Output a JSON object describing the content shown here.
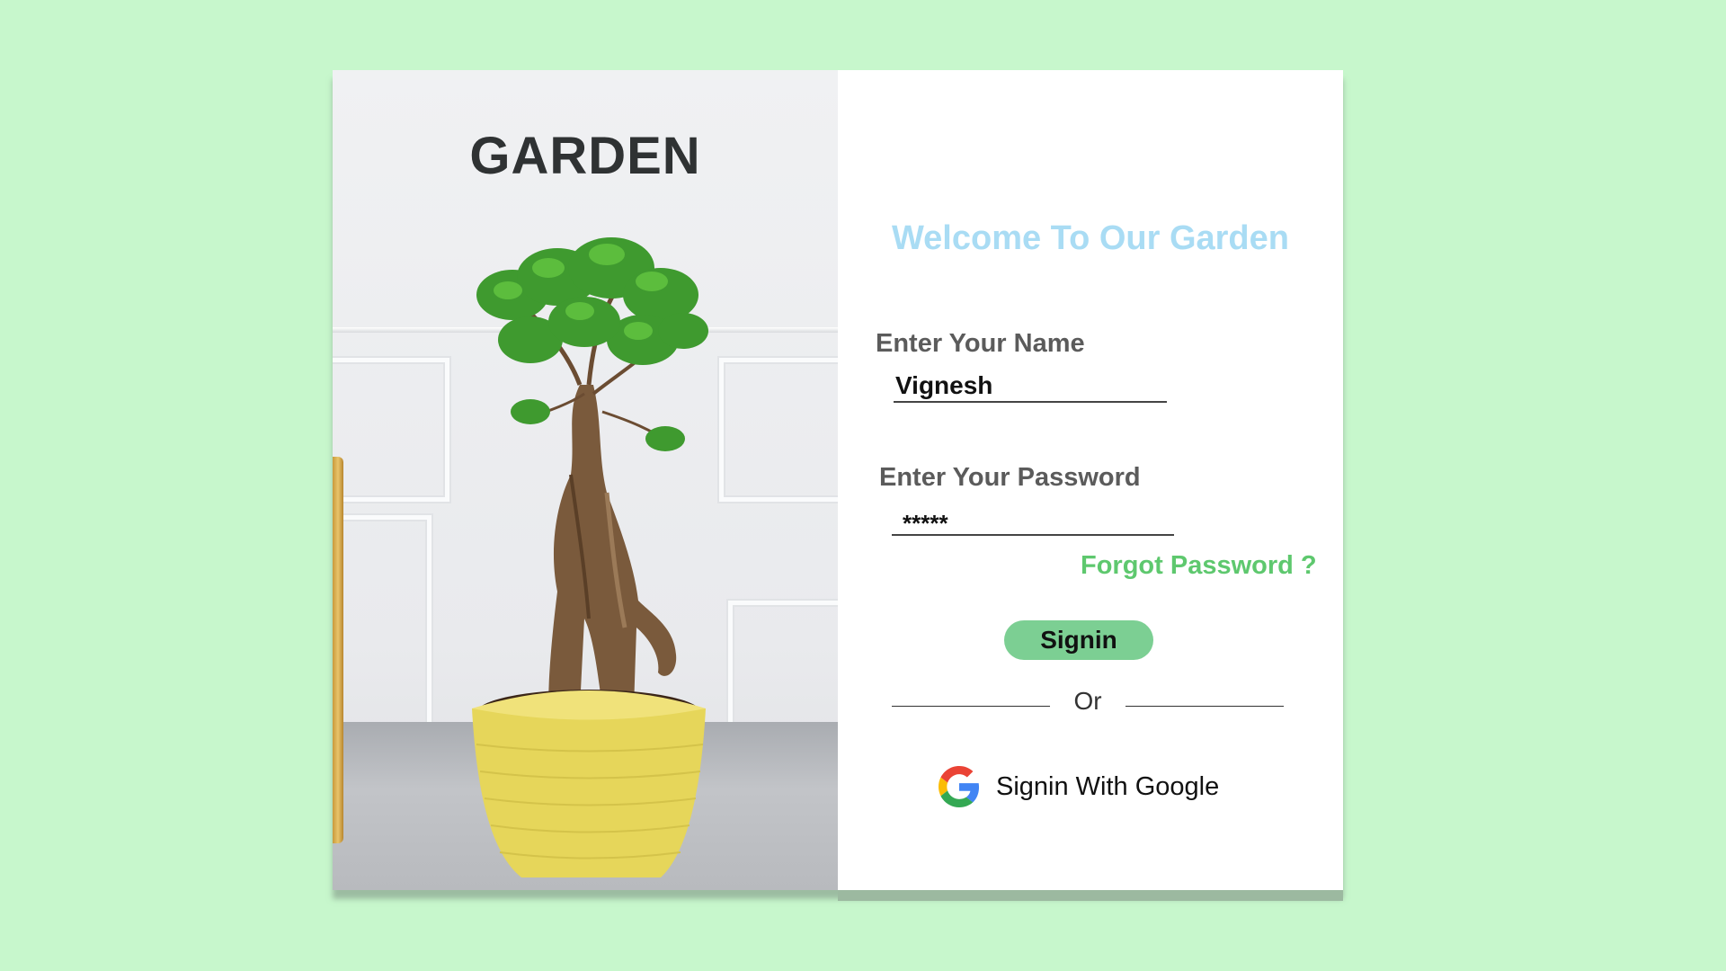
{
  "left": {
    "title": "GARDEN"
  },
  "right": {
    "welcome": "Welcome To Our Garden",
    "name_label": "Enter Your Name",
    "name_value": "Vignesh",
    "password_label": "Enter Your Password",
    "password_value": "*****",
    "forgot": "Forgot Password ?",
    "signin": "Signin",
    "or": "Or",
    "google_signin": "Signin With Google"
  },
  "colors": {
    "background": "#c7f7cc",
    "welcome": "#a9dcf4",
    "accent_green": "#5ec86e",
    "button": "#7ccf93"
  },
  "icons": {
    "google": "google-logo-icon"
  }
}
